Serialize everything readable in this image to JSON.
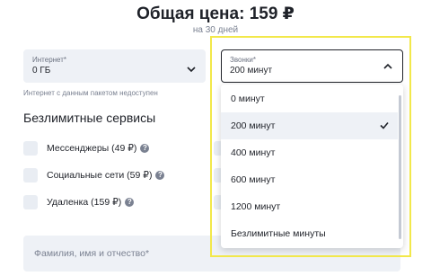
{
  "header": {
    "title": "Общая цена: 159 ₽",
    "subtitle": "на 30 дней"
  },
  "internet": {
    "label": "Интернет*",
    "value": "0 ГБ",
    "hint": "Интернет с данным пакетом недоступен"
  },
  "calls": {
    "label": "Звонки*",
    "value": "200 минут",
    "options": [
      {
        "label": "0 минут",
        "selected": false
      },
      {
        "label": "200 минут",
        "selected": true
      },
      {
        "label": "400 минут",
        "selected": false
      },
      {
        "label": "600 минут",
        "selected": false
      },
      {
        "label": "1200 минут",
        "selected": false
      },
      {
        "label": "Безлимитные минуты",
        "selected": false
      }
    ]
  },
  "unlimited": {
    "title": "Безлимитные сервисы",
    "items": [
      {
        "label": "Мессенджеры (49 ₽)",
        "help_icon": "?"
      },
      {
        "label": "Социальные сети (59 ₽)",
        "help_icon": "?"
      },
      {
        "label": "Удаленка (159 ₽)",
        "help_icon": "?"
      }
    ]
  },
  "form": {
    "name_placeholder": "Фамилия, имя и отчество*"
  },
  "colors": {
    "accent_highlight": "#f2e84a",
    "field_bg": "#eef1f6",
    "text": "#1f2229",
    "muted": "#7a8191"
  }
}
